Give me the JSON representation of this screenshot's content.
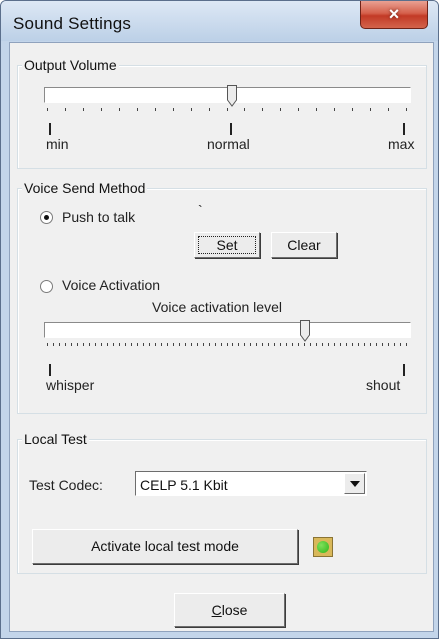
{
  "window": {
    "title": "Sound Settings",
    "close_glyph": "×"
  },
  "output_volume": {
    "group_label": "Output Volume",
    "slider_value_fraction": 0.5,
    "label_min": "min",
    "label_normal": "normal",
    "label_max": "max"
  },
  "voice_send": {
    "group_label": "Voice Send Method",
    "push_to_talk": {
      "label": "Push to talk",
      "selected": true,
      "hotkey": "`"
    },
    "set_button": "Set",
    "clear_button": "Clear",
    "voice_activation": {
      "label": "Voice Activation",
      "selected": false
    },
    "activation_level_title": "Voice activation level",
    "activation_level_fraction": 0.7,
    "label_whisper": "whisper",
    "label_shout": "shout"
  },
  "local_test": {
    "group_label": "Local Test",
    "codec_label": "Test Codec:",
    "codec_selected": "CELP 5.1 Kbit",
    "activate_button": "Activate local test mode",
    "status_color": "#2fb51a"
  },
  "footer": {
    "close_button_prefix": "",
    "close_button_mnemonic": "C",
    "close_button_rest": "lose"
  },
  "icons": {
    "close": "close-icon",
    "dropdown": "chevron-down-icon",
    "status": "status-led-icon"
  }
}
